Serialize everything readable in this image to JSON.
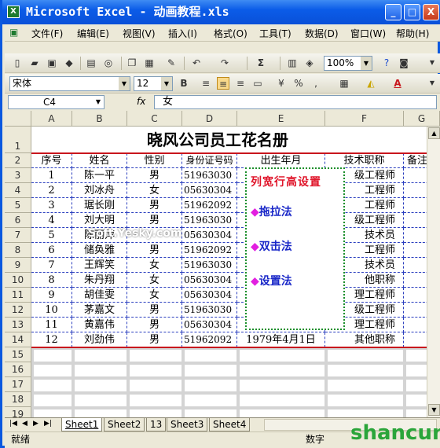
{
  "app": {
    "title": "Microsoft Excel - 动画教程.xls",
    "min": "_",
    "max": "□",
    "close": "X"
  },
  "menu": [
    "文件(F)",
    "编辑(E)",
    "视图(V)",
    "插入(I)",
    "格式(O)",
    "工具(T)",
    "数据(D)",
    "窗口(W)",
    "帮助(H)"
  ],
  "toolbar": {
    "zoom": "100%",
    "font": "宋体",
    "size": "12"
  },
  "formula": {
    "cellref": "C4",
    "fx": "fx",
    "content": "女"
  },
  "columns": [
    "A",
    "B",
    "C",
    "D",
    "E",
    "F",
    "G"
  ],
  "rows": [
    "1",
    "2",
    "3",
    "4",
    "5",
    "6",
    "7",
    "8",
    "9",
    "10",
    "11",
    "12",
    "13",
    "14",
    "15",
    "16",
    "17",
    "18",
    "19"
  ],
  "sheet": {
    "title": "晓风公司员工花名册",
    "headers": [
      "序号",
      "姓名",
      "性别",
      "身份证号码",
      "出生年月",
      "技术职称",
      "备注"
    ],
    "data": [
      [
        "1",
        "陈一平",
        "男",
        "51963030",
        "",
        "级工程师"
      ],
      [
        "2",
        "刘冰舟",
        "女",
        "05630304",
        "",
        "工程师"
      ],
      [
        "3",
        "琚长刚",
        "男",
        "51962092",
        "",
        "工程师"
      ],
      [
        "4",
        "刘大明",
        "男",
        "51963030",
        "",
        "级工程师"
      ],
      [
        "5",
        "陈丽萍",
        "",
        "05630304",
        "",
        "技术员"
      ],
      [
        "6",
        "储奂雅",
        "男",
        "51962092",
        "",
        "工程师"
      ],
      [
        "7",
        "王辉笑",
        "女",
        "51963030",
        "",
        "技术员"
      ],
      [
        "8",
        "朱丹翔",
        "女",
        "05630304",
        "",
        "他职称"
      ],
      [
        "9",
        "胡佳雯",
        "女",
        "05630304",
        "",
        "理工程师"
      ],
      [
        "10",
        "茅嘉文",
        "男",
        "51963030",
        "",
        "级工程师"
      ],
      [
        "11",
        "黄嘉伟",
        "男",
        "05630304",
        "",
        "理工程师"
      ],
      [
        "12",
        "刘劲伟",
        "男",
        "51962092",
        "1979年4月1日",
        "其他职称"
      ]
    ]
  },
  "popup": {
    "title": "列宽行高设置",
    "items": [
      "拖拉法",
      "双击法",
      "设置法"
    ]
  },
  "tabs": [
    "Sheet1",
    "Sheet2",
    "13",
    "Sheet3",
    "Sheet4"
  ],
  "status": {
    "ready": "就绪",
    "num": "数字"
  },
  "watermark": "Soft.Yesky.com",
  "brand": "shancun",
  "colors": {
    "title_bar": "#0b5ce8",
    "popup_title": "#e0162b",
    "popup_items": "#1a28c8",
    "bullet": "#e21fe0"
  }
}
